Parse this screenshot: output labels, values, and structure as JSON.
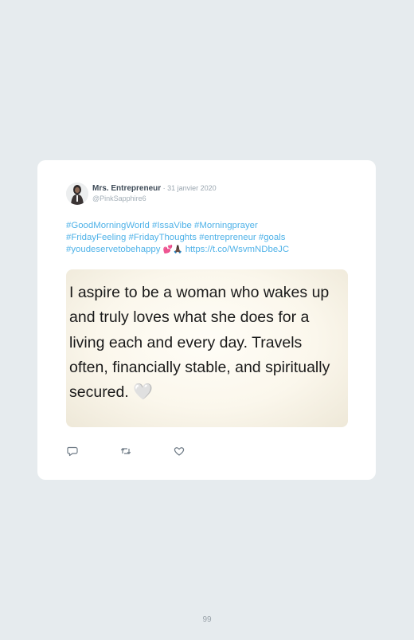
{
  "tweet": {
    "author_name": "Mrs. Entrepreneur",
    "date": " · 31 janvier 2020",
    "handle": "@PinkSapphire6",
    "text_lines": [
      "#GoodMorningWorld #IssaVibe #Morningprayer",
      "#FridayFeeling #FridayThoughts #entrepreneur #goals",
      "#youdeservetobehappy"
    ],
    "emojis": "💕🙏🏿",
    "link": "https://t.co/WsvmNDbeJC",
    "image_text_lines": [
      "I aspire to be a woman who wakes up",
      "and truly loves what she does for a",
      "living each and every day. Travels",
      "often, financially stable, and spiritually",
      "secured."
    ],
    "image_heart": "🤍"
  },
  "icons": {
    "reply": "reply-icon",
    "retweet": "retweet-icon",
    "like": "like-icon"
  },
  "page": {
    "number": "99"
  }
}
